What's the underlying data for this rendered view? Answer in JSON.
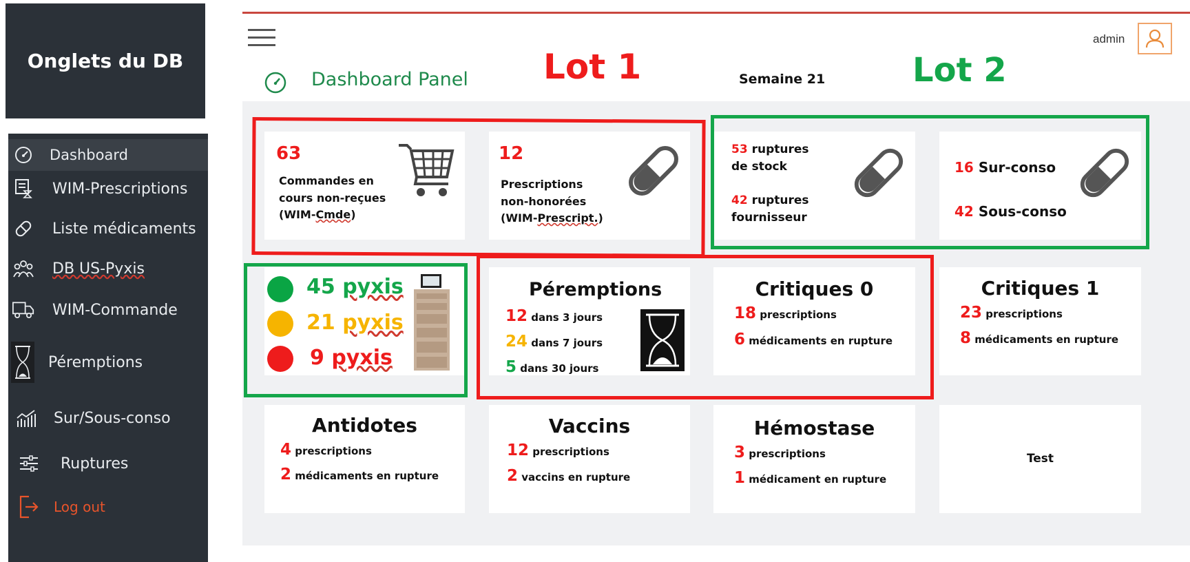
{
  "caption": "Onglets du DB",
  "sidebar": {
    "items": [
      {
        "label": "Dashboard",
        "icon": "speedometer-icon"
      },
      {
        "label": "WIM-Prescriptions",
        "icon": "prescription-icon"
      },
      {
        "label": "Liste médicaments",
        "icon": "pill-icon"
      },
      {
        "label": "DB US-Pyxis",
        "icon": "users-icon"
      },
      {
        "label": "WIM-Commande",
        "icon": "truck-icon"
      },
      {
        "label": "Péremptions",
        "icon": "hourglass-icon"
      },
      {
        "label": "Sur/Sous-conso",
        "icon": "chart-icon"
      },
      {
        "label": "Ruptures",
        "icon": "sliders-icon"
      }
    ],
    "logout": "Log out"
  },
  "header": {
    "user": "admin",
    "title": "Dashboard Panel",
    "week": "Semaine 21",
    "lot1": "Lot 1",
    "lot2": "Lot 2"
  },
  "cards": {
    "commandes": {
      "value": "63",
      "line1": "Commandes en",
      "line2": "cours non-reçues",
      "line3a": "(WIM-",
      "line3b": "Cmde",
      "line3c": ")"
    },
    "prescriptions": {
      "value": "12",
      "line1": "Prescriptions",
      "line2": "non-honorées",
      "line3a": "(WIM-",
      "line3b": "Prescript.",
      "line3c": ")"
    },
    "ruptures": {
      "v1": "53",
      "l1a": "ruptures",
      "l1b": "de stock",
      "v2": "42",
      "l2a": "ruptures",
      "l2b": "fournisseur"
    },
    "conso": {
      "v1": "16",
      "l1": "Sur-conso",
      "v2": "42",
      "l2": "Sous-conso"
    },
    "pyxis": {
      "green": "45",
      "orange": "21",
      "red": "9",
      "word": "pyxis"
    },
    "peremptions": {
      "title": "Péremptions",
      "rows": [
        {
          "value": "12",
          "label": "dans 3 jours"
        },
        {
          "value": "24",
          "label": "dans 7 jours"
        },
        {
          "value": "5",
          "label": "dans 30 jours"
        }
      ]
    },
    "critiques0": {
      "title": "Critiques 0",
      "v1": "18",
      "l1": "prescriptions",
      "v2": "6",
      "l2": "médicaments en rupture"
    },
    "critiques1": {
      "title": "Critiques 1",
      "v1": "23",
      "l1": "prescriptions",
      "v2": "8",
      "l2": "médicaments en rupture"
    },
    "antidotes": {
      "title": "Antidotes",
      "v1": "4",
      "l1": "prescriptions",
      "v2": "2",
      "l2": "médicaments en rupture"
    },
    "vaccins": {
      "title": "Vaccins",
      "v1": "12",
      "l1": "prescriptions",
      "v2": "2",
      "l2": "vaccins en rupture"
    },
    "hemostase": {
      "title": "Hémostase",
      "v1": "3",
      "l1": "prescriptions",
      "v2": "1",
      "l2": "médicament en rupture"
    },
    "test": {
      "title": "Test"
    }
  },
  "colors": {
    "lot1": "#ee1c1c",
    "lot2": "#14a64a",
    "sidebar": "#2b3138",
    "accent_title": "#1f8a4c"
  }
}
